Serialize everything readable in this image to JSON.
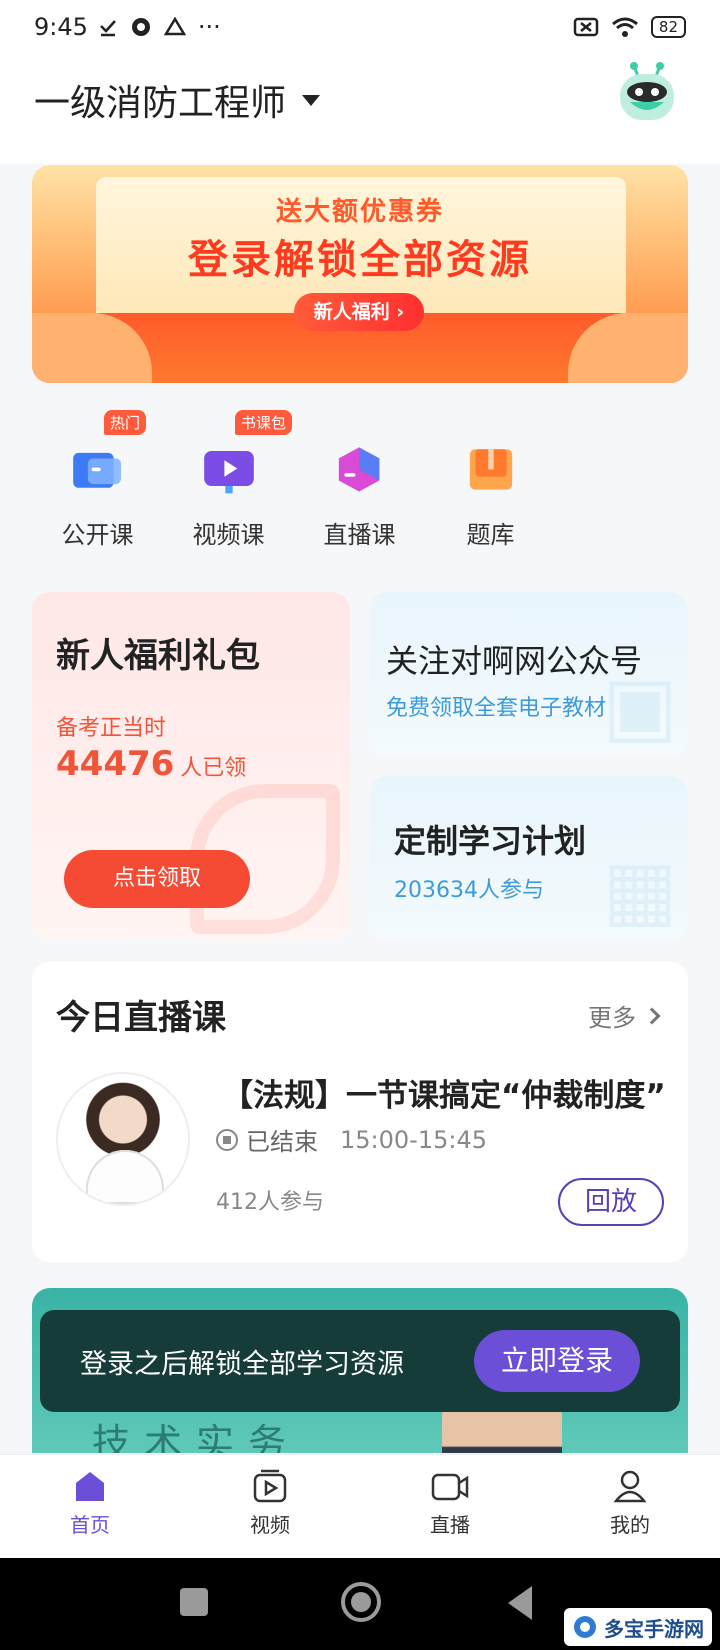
{
  "status_bar": {
    "time": "9:45",
    "battery": "82"
  },
  "header": {
    "title": "一级消防工程师"
  },
  "banner": {
    "subtitle": "送大额优惠券",
    "title": "登录解锁全部资源",
    "button": "新人福利 ›"
  },
  "quick_nav": [
    {
      "label": "公开课",
      "badge": "热门",
      "icon": "open-class-icon"
    },
    {
      "label": "视频课",
      "badge": "书课包",
      "icon": "video-class-icon"
    },
    {
      "label": "直播课",
      "badge": "",
      "icon": "live-class-icon"
    },
    {
      "label": "题库",
      "badge": "",
      "icon": "question-bank-icon"
    }
  ],
  "newbie_card": {
    "title": "新人福利礼包",
    "subtitle": "备考正当时",
    "count": "44476",
    "count_unit": "人已领",
    "button": "点击领取"
  },
  "follow_card": {
    "title": "关注对啊网公众号",
    "subtitle": "免费领取全套电子教材"
  },
  "plan_card": {
    "title": "定制学习计划",
    "subtitle": "203634人参与"
  },
  "live_section": {
    "heading": "今日直播课",
    "more": "更多",
    "course": {
      "title": "【法规】一节课搞定“仲裁制度”",
      "status": "已结束",
      "time": "15:00-15:45",
      "participants": "412人参与",
      "button": "回放"
    }
  },
  "promo": {
    "text": "技术实务"
  },
  "login_bar": {
    "message": "登录之后解锁全部学习资源",
    "button": "立即登录"
  },
  "tab_bar": [
    {
      "label": "首页",
      "icon": "home-icon",
      "active": true
    },
    {
      "label": "视频",
      "icon": "video-icon",
      "active": false
    },
    {
      "label": "直播",
      "icon": "camera-icon",
      "active": false
    },
    {
      "label": "我的",
      "icon": "person-icon",
      "active": false
    }
  ],
  "watermark": {
    "text": "多宝手游网"
  },
  "colors": {
    "accent": "#6b4fd6",
    "orange": "#f54b35",
    "blue": "#3c9bd9"
  }
}
